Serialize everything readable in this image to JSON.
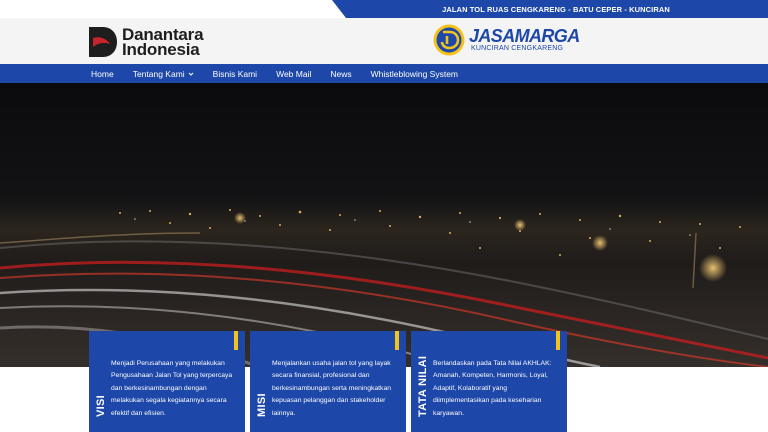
{
  "top_banner": {
    "route_text": "JALAN TOL RUAS CENGKARENG - BATU CEPER - KUNCIRAN"
  },
  "header": {
    "danantara": {
      "line1": "Danantara",
      "line2": "Indonesia"
    },
    "jasamarga": {
      "name": "JASAMARGA",
      "subtitle": "KUNCIRAN CENGKARENG"
    }
  },
  "nav": {
    "items": [
      {
        "label": "Home"
      },
      {
        "label": "Tentang Kami",
        "icon": "chevron-down-icon"
      },
      {
        "label": "Bisnis Kami"
      },
      {
        "label": "Web Mail"
      },
      {
        "label": "News"
      },
      {
        "label": "Whistleblowing System"
      }
    ]
  },
  "cards": [
    {
      "title": "VISI",
      "text": "Menjadi Perusahaan yang melakukan Pengusahaan Jalan Tol yang terpercaya dan berkesinambungan dengan melakukan segala kegiatannya secara efektif dan efisien."
    },
    {
      "title": "MISI",
      "text": "Menjalankan usaha jalan tol yang layak secara finansial, profesional dan berkesinambungan serta meningkatkan kepuasan pelanggan dan stakeholder lainnya."
    },
    {
      "title": "TATA NILAI",
      "text": "Berlandaskan pada Tata Nilai AKHLAK: Amanah, Kompeten, Harmonis, Loyal, Adaptif, Kolaboratif yang diimplementasikan pada keseharian karyawan."
    }
  ],
  "colors": {
    "brand_blue": "#1d47a8",
    "accent_yellow": "#f4c21c",
    "danantara_red": "#c8242b"
  }
}
